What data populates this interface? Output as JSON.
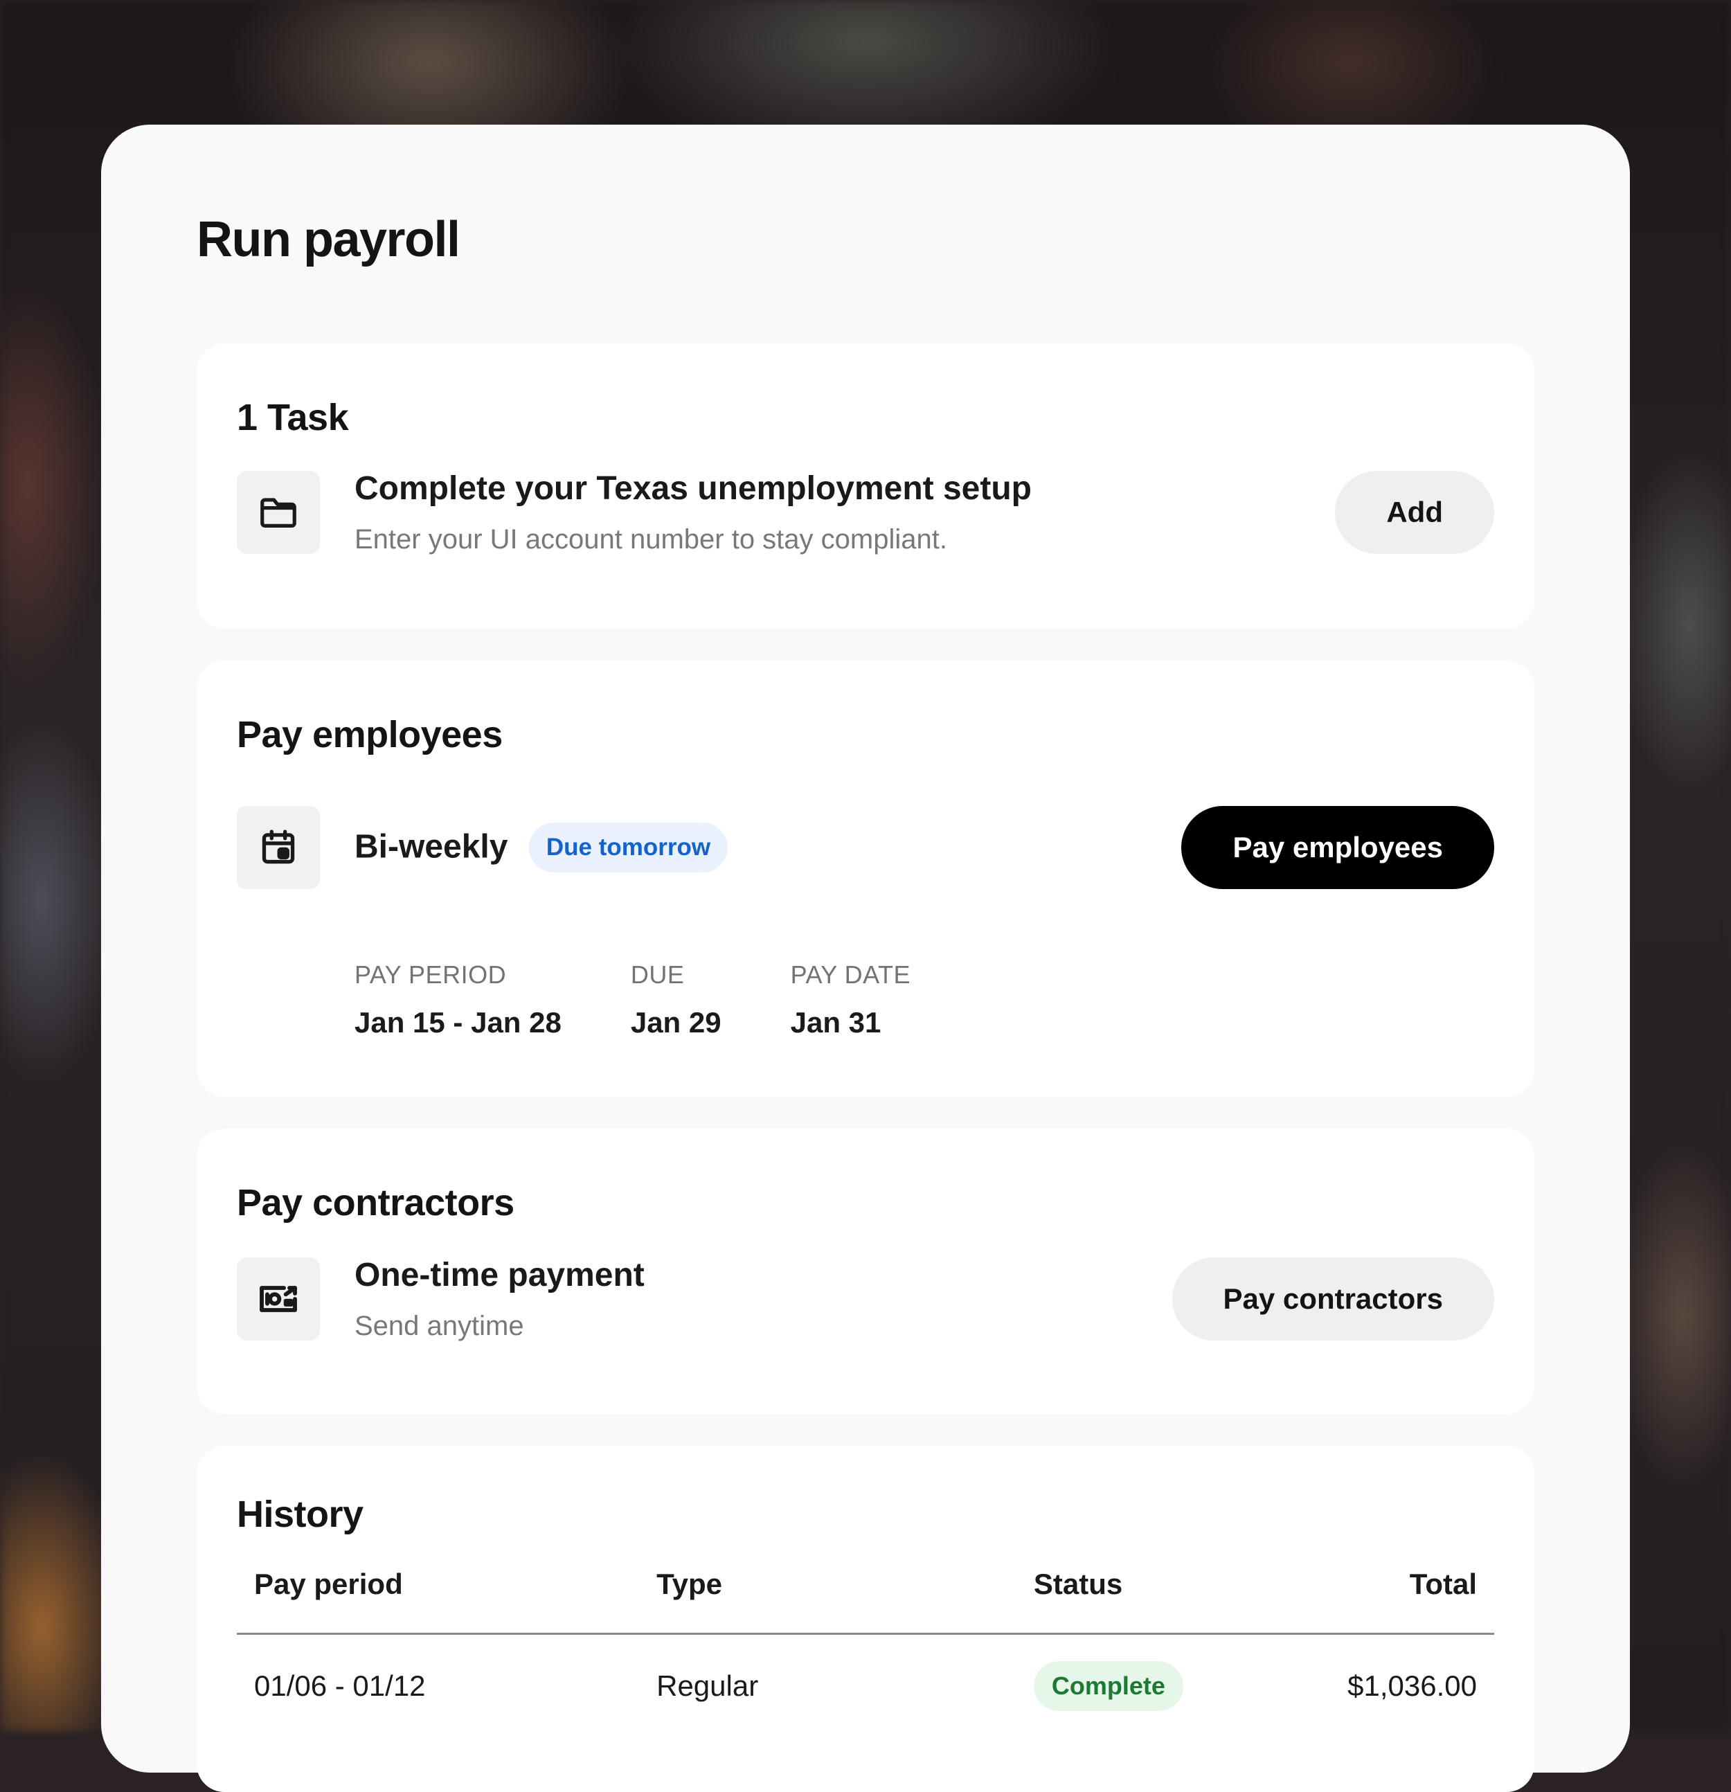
{
  "page": {
    "title": "Run payroll"
  },
  "tasks": {
    "heading": "1 Task",
    "item": {
      "icon": "folder-icon",
      "title": "Complete your Texas unemployment setup",
      "subtitle": "Enter your UI account number to stay compliant.",
      "button_label": "Add"
    }
  },
  "pay_employees": {
    "heading": "Pay employees",
    "schedule": {
      "icon": "calendar-icon",
      "label": "Bi-weekly",
      "badge": "Due tomorrow",
      "button_label": "Pay employees"
    },
    "meta": [
      {
        "label": "PAY PERIOD",
        "value": "Jan 15 - Jan 28"
      },
      {
        "label": "DUE",
        "value": "Jan 29"
      },
      {
        "label": "PAY DATE",
        "value": "Jan 31"
      }
    ]
  },
  "pay_contractors": {
    "heading": "Pay contractors",
    "item": {
      "icon": "money-icon",
      "title": "One-time payment",
      "subtitle": "Send anytime",
      "button_label": "Pay contractors"
    }
  },
  "history": {
    "heading": "History",
    "columns": [
      "Pay period",
      "Type",
      "Status",
      "Total"
    ],
    "rows": [
      {
        "pay_period": "01/06 - 01/12",
        "type": "Regular",
        "status": "Complete",
        "total": "$1,036.00"
      }
    ]
  },
  "colors": {
    "primary_button": "#000000",
    "due_badge_text": "#1463cc",
    "due_badge_bg": "#e8f1fd",
    "complete_badge_text": "#1c7a35",
    "complete_badge_bg": "#e6f7ea"
  }
}
